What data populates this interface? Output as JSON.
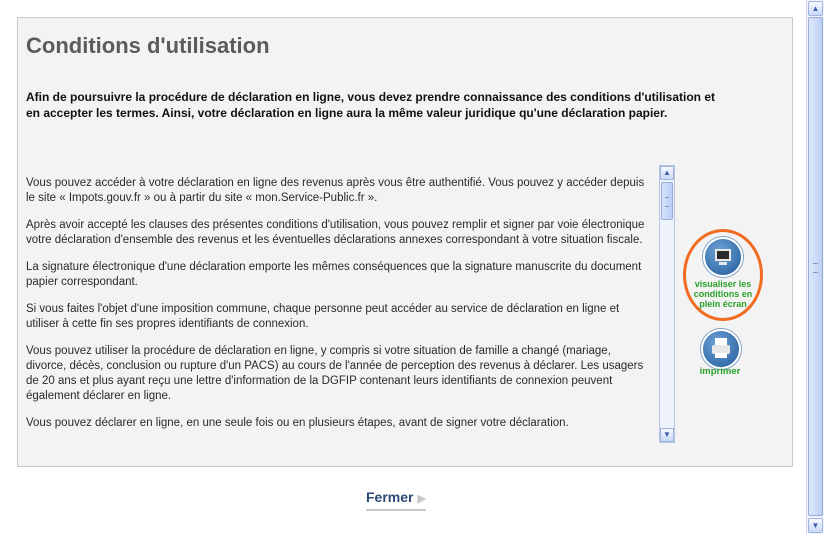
{
  "header": {
    "title": "Conditions d'utilisation",
    "intro": "Afin de poursuivre la procédure de déclaration en ligne, vous devez prendre connaissance des conditions d'utilisation et en accepter les termes. Ainsi, votre déclaration en ligne aura la même valeur juridique qu'une déclaration papier."
  },
  "conditions": {
    "paragraphs": [
      "Vous pouvez accéder à votre déclaration en ligne des revenus après vous être authentifié. Vous pouvez y accéder depuis le site « Impots.gouv.fr » ou à partir du site « mon.Service-Public.fr ».",
      "Après avoir accepté les clauses des présentes conditions d'utilisation, vous pouvez remplir et signer par voie électronique votre déclaration d'ensemble des revenus et les éventuelles déclarations annexes correspondant à votre situation fiscale.",
      "La signature électronique d'une déclaration emporte les mêmes conséquences que la signature manuscrite du document papier correspondant.",
      "Si vous faites l'objet d'une imposition commune, chaque personne peut accéder au service de déclaration en ligne et utiliser à cette fin ses propres identifiants de connexion.",
      "Vous pouvez utiliser la procédure de déclaration en ligne, y compris si votre situation de famille a changé (mariage, divorce, décès, conclusion ou rupture d'un PACS) au cours de l'année de perception des revenus à déclarer. Les usagers de 20 ans et plus ayant reçu une lettre d'information de la DGFIP contenant leurs identifiants de connexion peuvent également déclarer en ligne.",
      "Vous pouvez déclarer en ligne, en une seule fois ou en plusieurs étapes, avant de signer votre déclaration."
    ]
  },
  "actions": {
    "fullscreen_label": "visualiser les conditions en plein écran",
    "print_label": "imprimer",
    "close_label": "Fermer",
    "close_arrow": "▶"
  },
  "icons": {
    "fullscreen": "monitor-icon",
    "print": "printer-icon",
    "scroll_up": "▲",
    "scroll_down": "▼"
  },
  "colors": {
    "action_label": "#2aa12a",
    "highlight_ring": "#f26b20",
    "close_link": "#2b4a75"
  }
}
